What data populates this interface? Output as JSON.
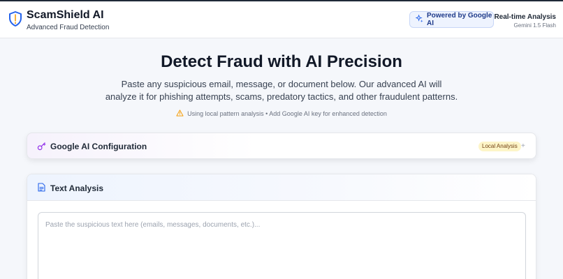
{
  "header": {
    "brand_title": "ScamShield AI",
    "brand_subtitle": "Advanced Fraud Detection",
    "powered_label": "Powered by Google AI",
    "realtime_title": "Real-time Analysis",
    "realtime_model": "Gemini 1.5 Flash"
  },
  "hero": {
    "title": "Detect Fraud with AI Precision",
    "description": "Paste any suspicious email, message, or document below. Our advanced AI will analyze it for phishing attempts, scams, predatory tactics, and other fraudulent patterns.",
    "notice": "Using local pattern analysis • Add Google AI key for enhanced detection"
  },
  "config": {
    "title": "Google AI Configuration",
    "badge": "Local Analysis",
    "expand_glyph": "+"
  },
  "analysis": {
    "title": "Text Analysis",
    "placeholder": "Paste the suspicious text here (emails, messages, documents, etc.)...",
    "value": ""
  },
  "icons": {
    "logo": "shield-icon",
    "powered": "sparkles-icon",
    "notice": "warning-icon",
    "config": "key-icon",
    "analysis": "document-icon"
  },
  "colors": {
    "accent_blue": "#2563eb",
    "key_purple": "#9333ea",
    "warning_amber": "#f59e0b",
    "badge_bg": "#fdf5c8"
  }
}
